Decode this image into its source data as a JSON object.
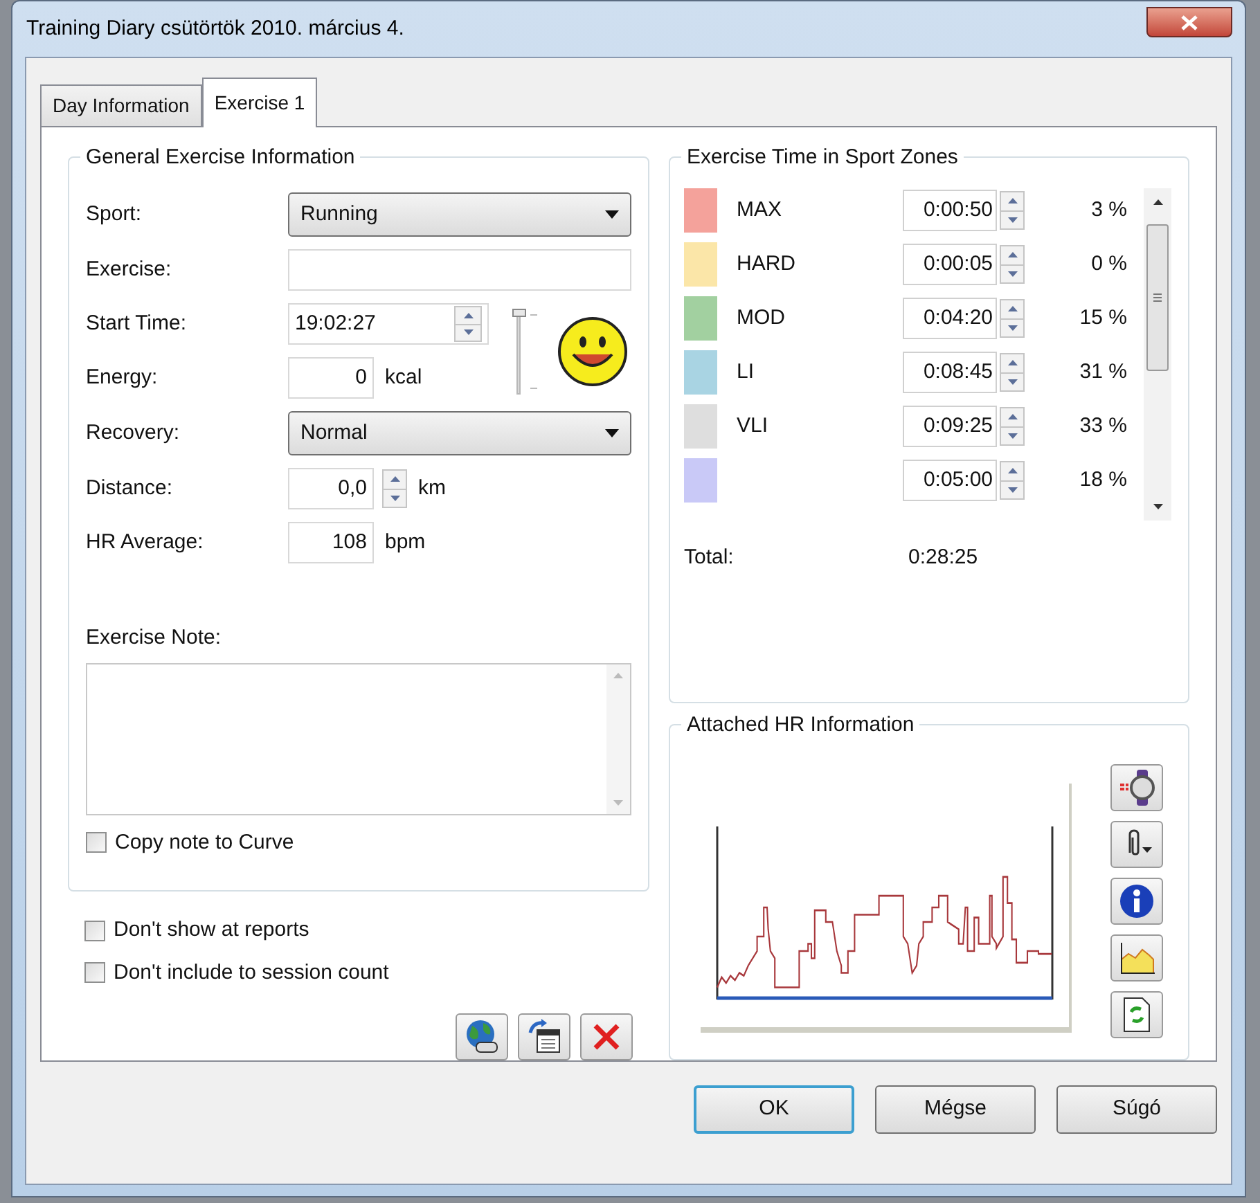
{
  "window": {
    "title": "Training Diary csütörtök 2010. március 4."
  },
  "tabs": [
    {
      "label": "Day Information",
      "selected": false
    },
    {
      "label": "Exercise 1",
      "selected": true
    }
  ],
  "general": {
    "title": "General Exercise Information",
    "fields": [
      {
        "kind": "dropdown",
        "label": "Sport:",
        "value": "Running"
      },
      {
        "kind": "text",
        "label": "Exercise:"
      },
      {
        "kind": "time",
        "label": "Start Time:",
        "value": "19:02:27"
      },
      {
        "kind": "number",
        "label": "Energy:",
        "value": "0",
        "unit": "kcal"
      },
      {
        "kind": "dropdown",
        "label": "Recovery:",
        "value": "Normal"
      },
      {
        "kind": "spin",
        "label": "Distance:",
        "value": "0,0",
        "unit": "km"
      },
      {
        "kind": "number",
        "label": "HR Average:",
        "value": "108",
        "unit": "bpm"
      }
    ],
    "feeling": {
      "level": 1
    },
    "note_label": "Exercise Note:",
    "copy_note": {
      "label": "Copy note to Curve",
      "checked": false
    }
  },
  "options": [
    {
      "label": "Don't show at reports",
      "checked": false
    },
    {
      "label": "Don't include to session count",
      "checked": false
    }
  ],
  "zones": {
    "title": "Exercise Time in Sport Zones",
    "rows": [
      {
        "name": "MAX",
        "color": "#f4a29b",
        "time": "0:00:50",
        "percent": "3 %"
      },
      {
        "name": "HARD",
        "color": "#fbe6a8",
        "time": "0:00:05",
        "percent": "0 %"
      },
      {
        "name": "MOD",
        "color": "#a2d0a0",
        "time": "0:04:20",
        "percent": "15 %"
      },
      {
        "name": "LI",
        "color": "#a9d4e3",
        "time": "0:08:45",
        "percent": "31 %"
      },
      {
        "name": "VLI",
        "color": "#dedede",
        "time": "0:09:25",
        "percent": "33 %"
      },
      {
        "color": "#c9c9f7",
        "time": "0:05:00",
        "percent": "18 %"
      }
    ],
    "total_label": "Total:",
    "total": "0:28:25"
  },
  "hr": {
    "title": "Attached HR Information"
  },
  "buttons": [
    {
      "label": "OK",
      "default": true
    },
    {
      "label": "Mégse",
      "default": false
    },
    {
      "label": "Súgó",
      "default": false
    }
  ]
}
